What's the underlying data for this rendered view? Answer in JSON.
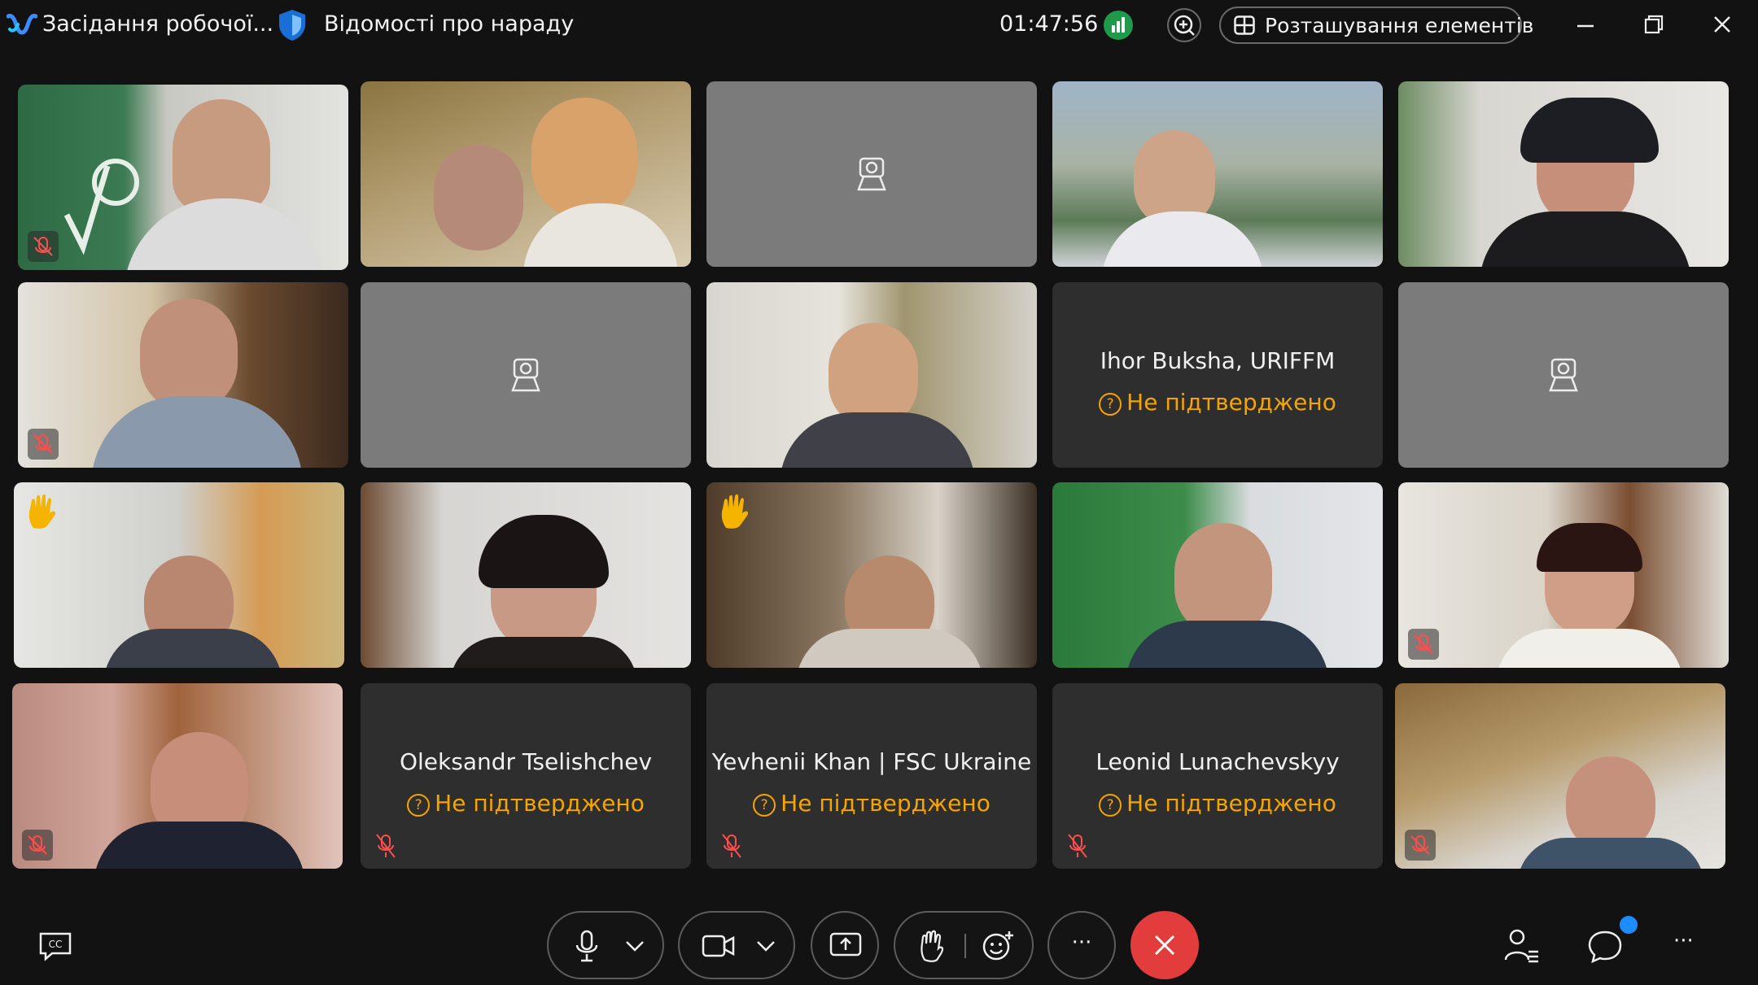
{
  "titlebar": {
    "meeting_title": "Засідання робочої...",
    "info_label": "Відомості про нараду",
    "timer": "01:47:56",
    "layout_button": "Розташування елементів",
    "icons": [
      "webex-logo-icon",
      "shield-icon",
      "signal-strength-icon",
      "zoom-in-icon",
      "layout-grid-icon",
      "minimize-icon",
      "restore-icon",
      "close-icon"
    ]
  },
  "participants": [
    {
      "row": 1,
      "col": 1,
      "kind": "video",
      "muted": true
    },
    {
      "row": 1,
      "col": 2,
      "kind": "video",
      "muted": false
    },
    {
      "row": 1,
      "col": 3,
      "kind": "camera-off",
      "muted": false
    },
    {
      "row": 1,
      "col": 4,
      "kind": "video",
      "muted": false
    },
    {
      "row": 1,
      "col": 5,
      "kind": "video",
      "muted": false
    },
    {
      "row": 2,
      "col": 1,
      "kind": "video",
      "muted": true
    },
    {
      "row": 2,
      "col": 2,
      "kind": "camera-off",
      "muted": false
    },
    {
      "row": 2,
      "col": 3,
      "kind": "video",
      "muted": false
    },
    {
      "row": 2,
      "col": 4,
      "kind": "name",
      "name": "Ihor Buksha, URIFFM",
      "status": "Не підтверджено",
      "muted": false
    },
    {
      "row": 2,
      "col": 5,
      "kind": "camera-off",
      "muted": false
    },
    {
      "row": 3,
      "col": 1,
      "kind": "video",
      "hand_raised": true,
      "muted": false
    },
    {
      "row": 3,
      "col": 2,
      "kind": "video",
      "muted": false
    },
    {
      "row": 3,
      "col": 3,
      "kind": "video",
      "hand_raised": true,
      "muted": false
    },
    {
      "row": 3,
      "col": 4,
      "kind": "video",
      "muted": false
    },
    {
      "row": 3,
      "col": 5,
      "kind": "video",
      "muted": true
    },
    {
      "row": 4,
      "col": 1,
      "kind": "video",
      "muted": true
    },
    {
      "row": 4,
      "col": 2,
      "kind": "name",
      "name": "Oleksandr Tselishchev",
      "status": "Не підтверджено",
      "muted": true
    },
    {
      "row": 4,
      "col": 3,
      "kind": "name",
      "name": "Yevhenii Khan | FSC Ukraine",
      "status": "Не підтверджено",
      "muted": true
    },
    {
      "row": 4,
      "col": 4,
      "kind": "name",
      "name": "Leonid Lunachevskyy",
      "status": "Не підтверджено",
      "muted": true
    },
    {
      "row": 4,
      "col": 5,
      "kind": "video",
      "muted": true
    }
  ],
  "status_symbol": "?",
  "controls": {
    "items": [
      "captions-icon",
      "microphone-icon",
      "chevron-down-icon",
      "camera-icon",
      "chevron-down-icon",
      "share-screen-icon",
      "raise-hand-icon",
      "reactions-icon",
      "more-icon",
      "leave-icon",
      "participants-icon",
      "chat-icon",
      "more-options-icon"
    ],
    "captions_label": "CC",
    "more_label": "···"
  },
  "colors": {
    "background": "#121212",
    "tile_named": "#2e2e2e",
    "tile_camera_off": "#7b7b7b",
    "pending_status": "#f5a400",
    "leave_button": "#e23c3c",
    "signal": "#1f9a4a",
    "chat_badge": "#1c8cff"
  }
}
